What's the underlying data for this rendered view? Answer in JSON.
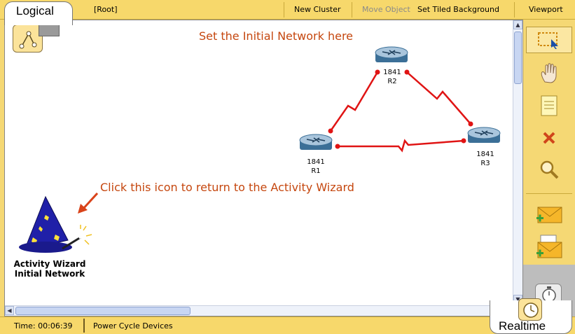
{
  "top_bar": {
    "tab_logical": "Logical",
    "root": "[Root]",
    "new_cluster": "New Cluster",
    "move_object": "Move Object",
    "set_tiled_background": "Set Tiled Background",
    "viewport": "Viewport"
  },
  "canvas": {
    "title_annotation": "Set the Initial Network here",
    "wizard_annotation": "Click this icon to return to the Activity Wizard",
    "wizard_label_line1": "Activity Wizard",
    "wizard_label_line2": "Initial Network",
    "devices": [
      {
        "model": "1841",
        "name": "R1"
      },
      {
        "model": "1841",
        "name": "R2"
      },
      {
        "model": "1841",
        "name": "R3"
      }
    ],
    "link_color": "#e01414",
    "annotation_color": "#c5470f"
  },
  "toolbar": {
    "icons": [
      "select-icon",
      "hand-icon",
      "note-icon",
      "delete-icon",
      "zoom-icon",
      "add-simple-pdu-icon",
      "add-complex-pdu-icon"
    ]
  },
  "bottom_bar": {
    "time": "Time: 00:06:39",
    "power_cycle": "Power Cycle Devices",
    "tab_realtime": "Realtime"
  }
}
